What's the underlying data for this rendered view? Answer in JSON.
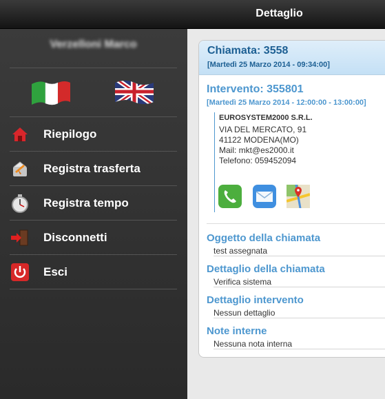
{
  "header": {
    "title": "Dettaglio"
  },
  "sidebar": {
    "user_name": "Verzelloni Marco",
    "flags": [
      {
        "name": "italian-flag",
        "language": "Italiano"
      },
      {
        "name": "uk-flag",
        "language": "English"
      }
    ],
    "menu": [
      {
        "label": "Riepilogo",
        "icon": "home-icon"
      },
      {
        "label": "Registra trasferta",
        "icon": "travel-icon"
      },
      {
        "label": "Registra tempo",
        "icon": "stopwatch-icon"
      },
      {
        "label": "Disconnetti",
        "icon": "logout-icon"
      },
      {
        "label": "Esci",
        "icon": "power-icon"
      }
    ]
  },
  "detail": {
    "call_title": "Chiamata: 3558",
    "call_date": "[Martedì 25 Marzo 2014 - 09:34:00]",
    "intervention_title": "Intervento: 355801",
    "intervention_date": "[Martedì 25 Marzo 2014 - 12:00:00 - 13:00:00]",
    "customer": {
      "company": "EUROSYSTEM2000 S.R.L.",
      "street": "VIA DEL MERCATO, 91",
      "city": "41122 MODENA(MO)",
      "mail": "Mail: mkt@es2000.it",
      "phone": "Telefono: 059452094"
    },
    "actions": [
      "phone-icon",
      "mail-icon",
      "maps-icon"
    ],
    "fields": [
      {
        "title": "Oggetto della chiamata",
        "value": "test assegnata"
      },
      {
        "title": "Dettaglio della chiamata",
        "value": "Verifica sistema"
      },
      {
        "title": "Dettaglio intervento",
        "value": "Nessun dettaglio"
      },
      {
        "title": "Note interne",
        "value": "Nessuna nota interna"
      }
    ]
  },
  "colors": {
    "accent": "#4d97cf",
    "header_text": "#1c5f93",
    "sidebar_bg": "#333333"
  }
}
